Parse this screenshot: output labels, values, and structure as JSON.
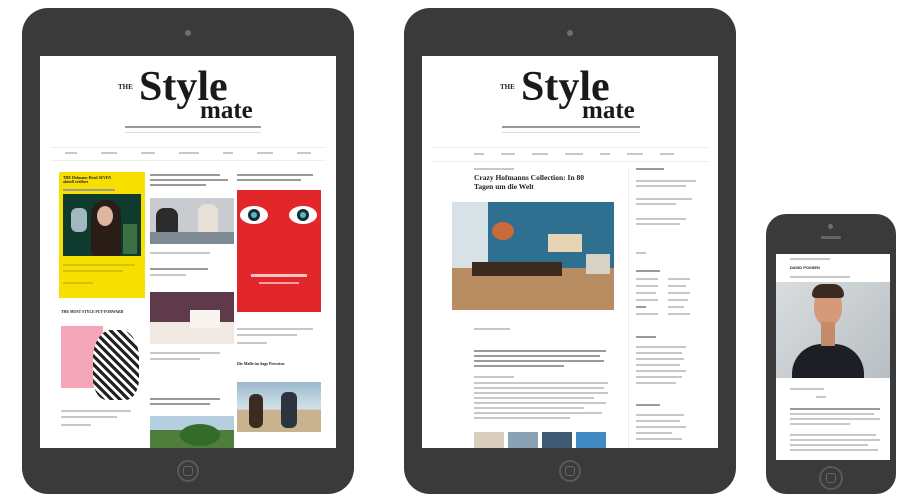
{
  "brand": {
    "the": "THE",
    "style": "Style",
    "mate": "mate"
  },
  "ipad_landscape": {
    "headlines": [
      "THE Hofmann-Hotel SEVEN aktuell eröffnet",
      "THE MOST STYLE PUT-FORWARD",
      "Die Malle im Sage Provoten"
    ]
  },
  "ipad_article": {
    "title": "Crazy Hofmanns Collection: In 80 Tagen um die Welt"
  },
  "phone": {
    "name": "DAVID POSSEN"
  },
  "colors": {
    "device": "#3a3a3a",
    "yellow_card": "#f7e000",
    "red_card": "#e2272a",
    "teal_wall": "#2f6f8f",
    "brand": "#1a1a1a"
  }
}
